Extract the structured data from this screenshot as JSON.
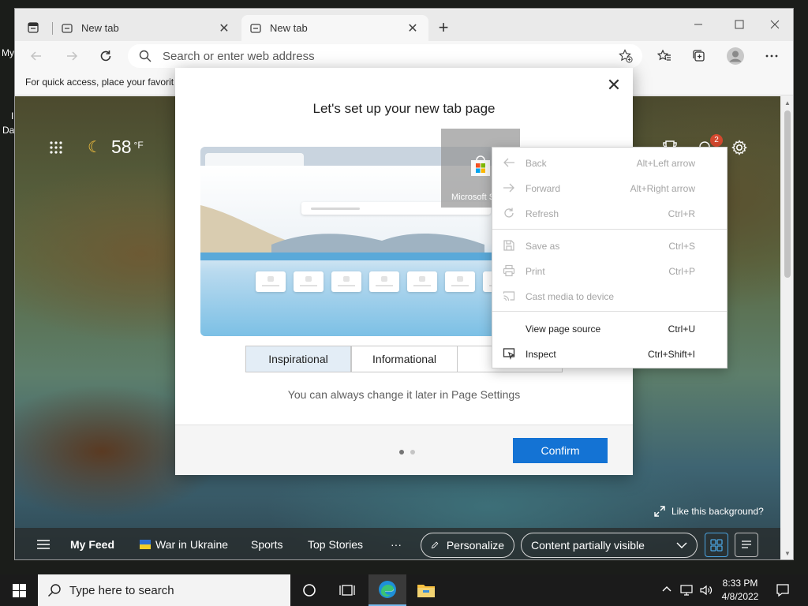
{
  "desktop": {
    "label_top": "My",
    "label_mid": "I",
    "label_bot": "Da"
  },
  "tabs": [
    {
      "label": "New tab",
      "close": "✕"
    },
    {
      "label": "New tab",
      "close": "✕"
    }
  ],
  "newtab_symbol": "+",
  "window": {
    "minimize": "—",
    "maximize": "☐",
    "close": "✕"
  },
  "address": {
    "placeholder": "Search or enter web address",
    "value": ""
  },
  "favbar_text": "For quick access, place your favorit",
  "page": {
    "temperature": "58",
    "temp_unit": "°F",
    "notification_count": "2",
    "like_background": "Like this background?"
  },
  "feed": {
    "items": [
      "My Feed",
      "War in Ukraine",
      "Sports",
      "Top Stories",
      "···"
    ],
    "personalize": "Personalize",
    "content_select": "Content partially visible"
  },
  "modal": {
    "title": "Let's set up your new tab page",
    "close": "✕",
    "options": [
      "Inspirational",
      "Informational",
      "I"
    ],
    "hint": "You can always change it later in Page Settings",
    "confirm": "Confirm",
    "page_dots": 2,
    "active_dot": 1
  },
  "store_ghost": {
    "label": "Microsoft Store"
  },
  "context_menu": [
    {
      "label": "Back",
      "shortcut": "Alt+Left arrow",
      "icon": "back-arrow-icon",
      "enabled": false
    },
    {
      "label": "Forward",
      "shortcut": "Alt+Right arrow",
      "icon": "forward-arrow-icon",
      "enabled": false
    },
    {
      "label": "Refresh",
      "shortcut": "Ctrl+R",
      "icon": "refresh-icon",
      "enabled": false
    },
    {
      "label": "Save as",
      "shortcut": "Ctrl+S",
      "icon": "save-icon",
      "enabled": false
    },
    {
      "label": "Print",
      "shortcut": "Ctrl+P",
      "icon": "print-icon",
      "enabled": false
    },
    {
      "label": "Cast media to device",
      "shortcut": "",
      "icon": "cast-icon",
      "enabled": false
    },
    {
      "label": "View page source",
      "shortcut": "Ctrl+U",
      "icon": "",
      "enabled": true
    },
    {
      "label": "Inspect",
      "shortcut": "Ctrl+Shift+I",
      "icon": "inspect-icon",
      "enabled": true
    }
  ],
  "taskbar": {
    "search_placeholder": "Type here to search",
    "time": "8:33 PM",
    "date": "4/8/2022"
  },
  "colors": {
    "accent": "#1473d4",
    "badge": "#d4492f",
    "taskbar": "#1b1b1b"
  }
}
